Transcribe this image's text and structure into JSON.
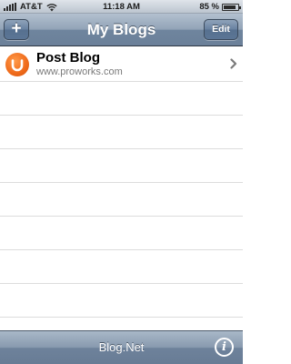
{
  "status_bar": {
    "carrier": "AT&T",
    "time": "11:18 AM",
    "battery_percent": "85 %",
    "battery_level": 0.85,
    "signal_icon": "signal-bars-icon",
    "wifi_icon": "wifi-icon"
  },
  "nav_bar": {
    "title": "My Blogs",
    "add_label": "+",
    "edit_label": "Edit"
  },
  "blogs": [
    {
      "title": "Post Blog",
      "url": "www.proworks.com",
      "icon": "blog-logo-icon",
      "accessory": "chevron-right-icon"
    }
  ],
  "toolbar": {
    "title": "Blog.Net",
    "info_label": "i"
  },
  "colors": {
    "nav_bar": "#6b8099",
    "blog_icon": "#ef6a1a",
    "subtitle_text": "#7a7a7a"
  }
}
